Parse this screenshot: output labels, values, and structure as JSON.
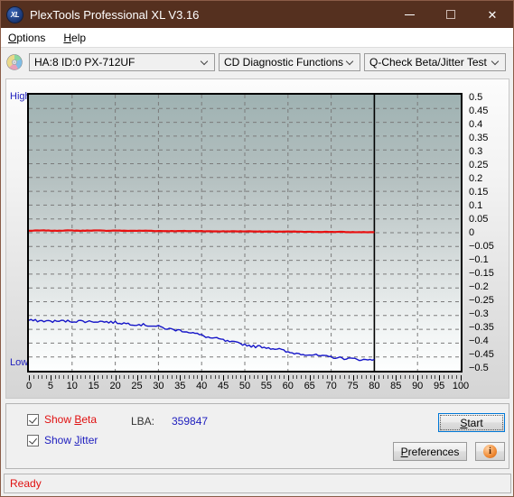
{
  "window": {
    "title": "PlexTools Professional XL V3.16",
    "app_icon": "xl-disc-icon",
    "icon_text": "XL",
    "titlebar_color": "#55301f",
    "minimize_label": "",
    "maximize_label": "",
    "close_label": "✕"
  },
  "menubar": {
    "items": [
      {
        "label": "Options",
        "accel": "O"
      },
      {
        "label": "Help",
        "accel": "H"
      }
    ]
  },
  "toolbar": {
    "drive_select": {
      "value": "HA:8 ID:0  PX-712UF",
      "options": [
        "HA:8 ID:0  PX-712UF"
      ]
    },
    "function_select": {
      "value": "CD Diagnostic Functions",
      "options": [
        "CD Diagnostic Functions"
      ]
    },
    "test_select": {
      "value": "Q-Check Beta/Jitter Test",
      "options": [
        "Q-Check Beta/Jitter Test"
      ]
    }
  },
  "chart_data": {
    "type": "line",
    "title": "",
    "xlabel": "",
    "ylabel": "",
    "xlim": [
      0,
      100
    ],
    "ylim": [
      -0.5,
      0.5
    ],
    "grid": true,
    "legend": "none",
    "y_axis_side": "right",
    "y_left_labels": {
      "top": "High",
      "bottom": "Low"
    },
    "xticks": [
      0,
      5,
      10,
      15,
      20,
      25,
      30,
      35,
      40,
      45,
      50,
      55,
      60,
      65,
      70,
      75,
      80,
      85,
      90,
      95,
      100
    ],
    "yticks": [
      0.5,
      0.45,
      0.4,
      0.35,
      0.3,
      0.25,
      0.2,
      0.15,
      0.1,
      0.05,
      0,
      -0.05,
      -0.1,
      -0.15,
      -0.2,
      -0.25,
      -0.3,
      -0.35,
      -0.4,
      -0.45,
      -0.5
    ],
    "data_end_marker_x": 80,
    "series": [
      {
        "name": "Beta",
        "color": "#e81010",
        "x": [
          0,
          2,
          4,
          6,
          8,
          10,
          12,
          14,
          16,
          18,
          20,
          22,
          24,
          26,
          28,
          30,
          32,
          34,
          36,
          38,
          40,
          42,
          44,
          46,
          48,
          50,
          52,
          54,
          56,
          58,
          60,
          62,
          64,
          66,
          68,
          70,
          72,
          74,
          76,
          78,
          80
        ],
        "values": [
          0.007,
          0.008,
          0.008,
          0.007,
          0.008,
          0.008,
          0.007,
          0.008,
          0.008,
          0.007,
          0.008,
          0.007,
          0.007,
          0.007,
          0.007,
          0.006,
          0.006,
          0.006,
          0.006,
          0.006,
          0.006,
          0.005,
          0.005,
          0.005,
          0.005,
          0.005,
          0.005,
          0.004,
          0.004,
          0.004,
          0.004,
          0.004,
          0.003,
          0.003,
          0.003,
          0.003,
          0.003,
          0.002,
          0.002,
          0.002,
          0.002
        ]
      },
      {
        "name": "Jitter",
        "color": "#1515c8",
        "x": [
          0,
          2,
          4,
          6,
          8,
          10,
          12,
          14,
          16,
          18,
          20,
          22,
          24,
          26,
          28,
          30,
          32,
          34,
          36,
          38,
          40,
          42,
          44,
          46,
          48,
          50,
          52,
          54,
          56,
          58,
          60,
          62,
          64,
          66,
          68,
          70,
          72,
          74,
          76,
          78,
          80
        ],
        "values": [
          -0.318,
          -0.319,
          -0.32,
          -0.321,
          -0.32,
          -0.321,
          -0.32,
          -0.322,
          -0.321,
          -0.323,
          -0.325,
          -0.328,
          -0.331,
          -0.333,
          -0.336,
          -0.34,
          -0.348,
          -0.352,
          -0.356,
          -0.363,
          -0.372,
          -0.381,
          -0.385,
          -0.394,
          -0.399,
          -0.405,
          -0.412,
          -0.413,
          -0.418,
          -0.422,
          -0.434,
          -0.437,
          -0.44,
          -0.443,
          -0.448,
          -0.45,
          -0.454,
          -0.456,
          -0.458,
          -0.461,
          -0.459
        ]
      }
    ]
  },
  "controls": {
    "show_beta": {
      "label_pre": "Show ",
      "label_accel": "B",
      "label_post": "eta",
      "checked": true,
      "color": "#e01010"
    },
    "show_jitter": {
      "label_pre": "Show ",
      "label_accel": "J",
      "label_post": "itter",
      "checked": true,
      "color": "#1d1dbe"
    },
    "lba_label": "LBA:",
    "lba_value": "359847",
    "start_button": {
      "pre": "",
      "accel": "S",
      "post": "tart"
    },
    "preferences_button": {
      "pre": "",
      "accel": "P",
      "post": "references"
    },
    "info_button": {
      "icon": "info-icon",
      "glyph": "i"
    }
  },
  "statusbar": {
    "text": "Ready",
    "color": "#e01010"
  }
}
